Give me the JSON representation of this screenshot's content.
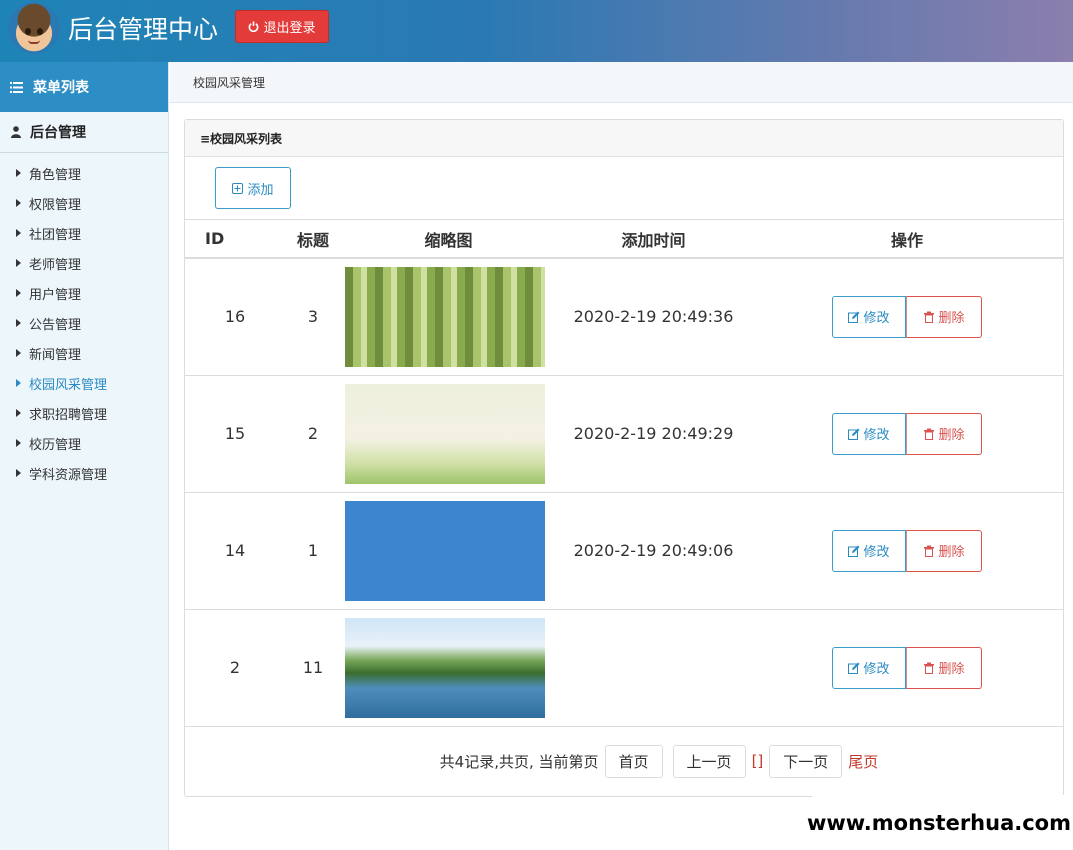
{
  "header": {
    "title": "后台管理中心",
    "logout_label": "退出登录"
  },
  "sidebar": {
    "head_label": "菜单列表",
    "group_label": "后台管理",
    "items": [
      {
        "label": "角色管理"
      },
      {
        "label": "权限管理"
      },
      {
        "label": "社团管理"
      },
      {
        "label": "老师管理"
      },
      {
        "label": "用户管理"
      },
      {
        "label": "公告管理"
      },
      {
        "label": "新闻管理"
      },
      {
        "label": "校园风采管理",
        "active": true
      },
      {
        "label": "求职招聘管理"
      },
      {
        "label": "校历管理"
      },
      {
        "label": "学科资源管理"
      }
    ]
  },
  "breadcrumb": "校园风采管理",
  "panel": {
    "title": "≡校园风采列表",
    "add_label": "添加",
    "columns": [
      "ID",
      "标题",
      "缩略图",
      "添加时间",
      "操作"
    ],
    "rows": [
      {
        "id": "16",
        "title": "3",
        "time": "2020-2-19 20:49:36",
        "thumb": "t1"
      },
      {
        "id": "15",
        "title": "2",
        "time": "2020-2-19 20:49:29",
        "thumb": "t2"
      },
      {
        "id": "14",
        "title": "1",
        "time": "2020-2-19 20:49:06",
        "thumb": "t3"
      },
      {
        "id": "2",
        "title": "11",
        "time": "",
        "thumb": "t4"
      }
    ],
    "edit_label": "修改",
    "delete_label": "删除"
  },
  "pager": {
    "summary": "共4记录,共页, 当前第页",
    "first": "首页",
    "prev": "上一页",
    "current": "[]",
    "next": "下一页",
    "last": "尾页"
  },
  "watermark": "www.monsterhua.com",
  "colors": {
    "accent": "#2a8bc3",
    "danger": "#d9534f",
    "header_start": "#1e84b6"
  }
}
